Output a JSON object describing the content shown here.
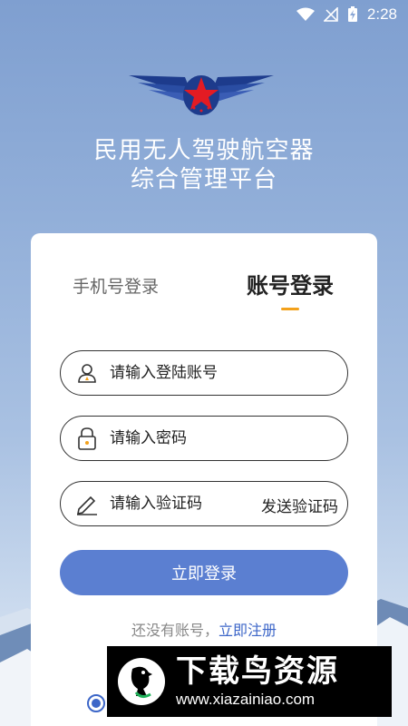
{
  "status_bar": {
    "time": "2:28"
  },
  "app": {
    "title_line1": "民用无人驾驶航空器",
    "title_line2": "综合管理平台"
  },
  "tabs": {
    "phone_login": "手机号登录",
    "account_login": "账号登录",
    "active": "account_login"
  },
  "fields": {
    "account_placeholder": "请输入登陆账号",
    "password_placeholder": "请输入密码",
    "code_placeholder": "请输入验证码",
    "send_code": "发送验证码"
  },
  "login_button": "立即登录",
  "register": {
    "prompt": "还没有账号，",
    "link": "立即注册"
  },
  "watermark": {
    "name": "下载鸟资源",
    "url": "www.xiazainiao.com"
  },
  "colors": {
    "primary": "#5b7fd1",
    "link": "#3c66c8",
    "tab_underline": "#f3a11b"
  },
  "icons": [
    "wifi-icon",
    "signal-icon",
    "battery-charging-icon",
    "user-icon",
    "lock-icon",
    "pen-icon"
  ]
}
